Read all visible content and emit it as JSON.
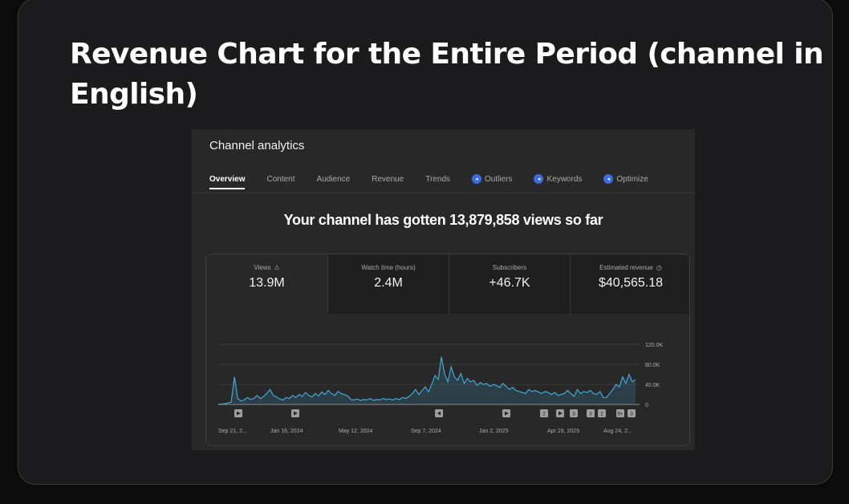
{
  "heading": "Revenue Chart for the Entire Period (channel in English)",
  "analytics": {
    "title": "Channel analytics",
    "tabs": [
      {
        "label": "Overview",
        "active": true,
        "badge": false
      },
      {
        "label": "Content",
        "active": false,
        "badge": false
      },
      {
        "label": "Audience",
        "active": false,
        "badge": false
      },
      {
        "label": "Revenue",
        "active": false,
        "badge": false
      },
      {
        "label": "Trends",
        "active": false,
        "badge": false
      },
      {
        "label": "Outliers",
        "active": false,
        "badge": true
      },
      {
        "label": "Keywords",
        "active": false,
        "badge": true
      },
      {
        "label": "Optimize",
        "active": false,
        "badge": true
      }
    ],
    "headline": "Your channel has gotten 13,879,858 views so far",
    "stats": [
      {
        "label": "Views",
        "value": "13.9M",
        "icon": "warning-icon"
      },
      {
        "label": "Watch time (hours)",
        "value": "2.4M",
        "icon": ""
      },
      {
        "label": "Subscribers",
        "value": "+46.7K",
        "icon": ""
      },
      {
        "label": "Estimated revenue",
        "value": "$40,565.18",
        "icon": "clock-icon"
      }
    ]
  },
  "chart_data": {
    "type": "area",
    "ylim": [
      0,
      120000
    ],
    "y_ticks": [
      "120.0K",
      "80.0K",
      "40.0K",
      "0"
    ],
    "x_tick_labels": [
      "Sep 21, 2...",
      "Jan 16, 2024",
      "May 12, 2024",
      "Sep 7, 2024",
      "Jan 2, 2025",
      "Apr 29, 2025",
      "Aug 24, 2..."
    ],
    "color": "#41a8d6",
    "series": [
      {
        "values": [
          500,
          800,
          1500,
          3000,
          5000,
          55000,
          12000,
          7000,
          9000,
          14000,
          10000,
          12000,
          18000,
          12000,
          16000,
          22000,
          30000,
          18000,
          15000,
          11000,
          9000,
          14000,
          12000,
          18000,
          14000,
          20000,
          16000,
          24000,
          18000,
          15000,
          22000,
          17000,
          25000,
          20000,
          28000,
          22000,
          18000,
          26000,
          22000,
          20000,
          17000,
          10000,
          9000,
          11000,
          8000,
          10000,
          9000,
          12000,
          8000,
          10000,
          9000,
          12000,
          10000,
          11000,
          9000,
          12000,
          10000,
          14000,
          12000,
          16000,
          22000,
          30000,
          20000,
          28000,
          35000,
          25000,
          40000,
          58000,
          50000,
          95000,
          60000,
          45000,
          75000,
          55000,
          48000,
          62000,
          42000,
          52000,
          45000,
          48000,
          38000,
          44000,
          40000,
          42000,
          36000,
          40000,
          38000,
          34000,
          42000,
          36000,
          30000,
          34000,
          28000,
          26000,
          24000,
          22000,
          30000,
          26000,
          28000,
          25000,
          22000,
          26000,
          24000,
          20000,
          24000,
          18000,
          20000,
          22000,
          28000,
          22000,
          16000,
          30000,
          22000,
          26000,
          24000,
          28000,
          22000,
          20000,
          26000,
          14000,
          14000,
          22000,
          30000,
          40000,
          35000,
          55000,
          42000,
          60000,
          45000,
          50000
        ]
      }
    ],
    "markers": [
      {
        "label": "",
        "icon": "play-icon"
      },
      {
        "label": "",
        "icon": "play-icon"
      },
      {
        "label": "",
        "icon": "megaphone-icon"
      },
      {
        "label": "",
        "icon": "play-icon"
      },
      {
        "label": "2",
        "icon": ""
      },
      {
        "label": "",
        "icon": "play-icon"
      },
      {
        "label": "3",
        "icon": ""
      },
      {
        "label": "3",
        "icon": ""
      },
      {
        "label": "2",
        "icon": ""
      },
      {
        "label": "9+",
        "icon": ""
      },
      {
        "label": "3",
        "icon": ""
      }
    ]
  }
}
